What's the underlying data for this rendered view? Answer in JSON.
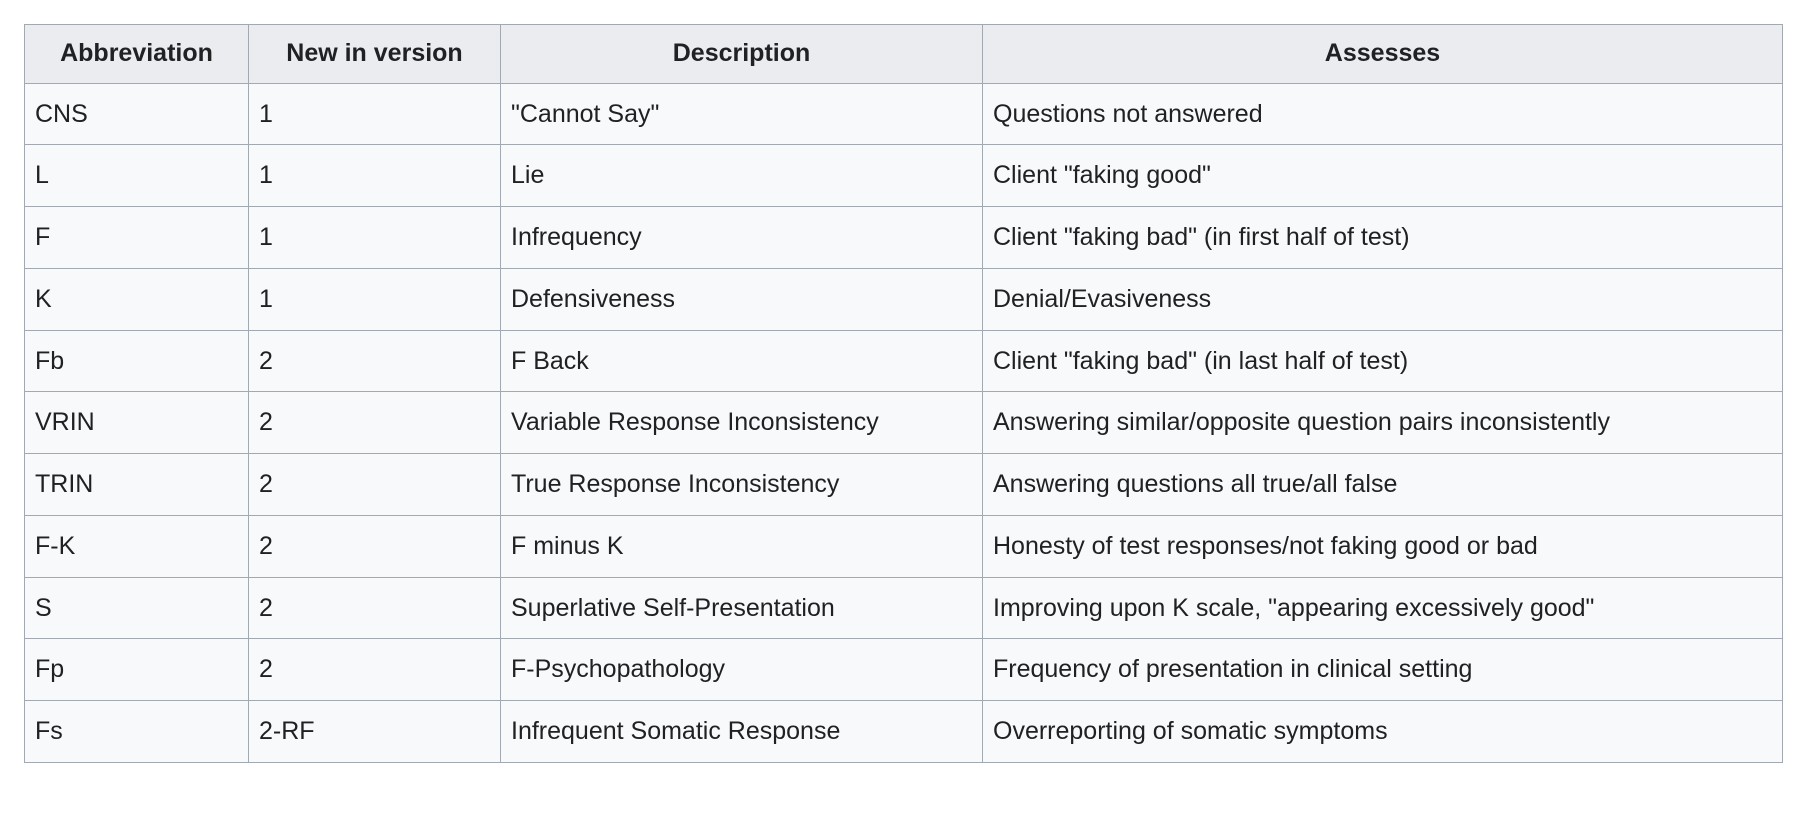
{
  "table": {
    "caption": "",
    "columns": [
      {
        "key": "abbreviation",
        "label": "Abbreviation",
        "align": "center"
      },
      {
        "key": "version",
        "label": "New in version",
        "align": "center"
      },
      {
        "key": "description",
        "label": "Description",
        "align": "center"
      },
      {
        "key": "assesses",
        "label": "Assesses",
        "align": "center"
      }
    ],
    "rows": [
      {
        "abbreviation": "CNS",
        "version": "1",
        "description": "\"Cannot Say\"",
        "assesses": "Questions not answered"
      },
      {
        "abbreviation": "L",
        "version": "1",
        "description": "Lie",
        "assesses": "Client \"faking good\""
      },
      {
        "abbreviation": "F",
        "version": "1",
        "description": "Infrequency",
        "assesses": "Client \"faking bad\" (in first half of test)"
      },
      {
        "abbreviation": "K",
        "version": "1",
        "description": "Defensiveness",
        "assesses": "Denial/Evasiveness"
      },
      {
        "abbreviation": "Fb",
        "version": "2",
        "description": "F Back",
        "assesses": "Client \"faking bad\" (in last half of test)"
      },
      {
        "abbreviation": "VRIN",
        "version": "2",
        "description": "Variable Response Inconsistency",
        "assesses": "Answering similar/opposite question pairs inconsistently"
      },
      {
        "abbreviation": "TRIN",
        "version": "2",
        "description": "True Response Inconsistency",
        "assesses": "Answering questions all true/all false"
      },
      {
        "abbreviation": "F-K",
        "version": "2",
        "description": "F minus K",
        "assesses": "Honesty of test responses/not faking good or bad"
      },
      {
        "abbreviation": "S",
        "version": "2",
        "description": "Superlative Self-Presentation",
        "assesses": "Improving upon K scale, \"appearing excessively good\""
      },
      {
        "abbreviation": "Fp",
        "version": "2",
        "description": "F-Psychopathology",
        "assesses": "Frequency of presentation in clinical setting"
      },
      {
        "abbreviation": "Fs",
        "version": "2-RF",
        "description": "Infrequent Somatic Response",
        "assesses": "Overreporting of somatic symptoms"
      }
    ]
  },
  "colors": {
    "page_background": "#ffffff",
    "cell_background": "#f8f9fa",
    "header_background": "#eaecf0",
    "border": "#a2a9b1",
    "text": "#202122"
  }
}
